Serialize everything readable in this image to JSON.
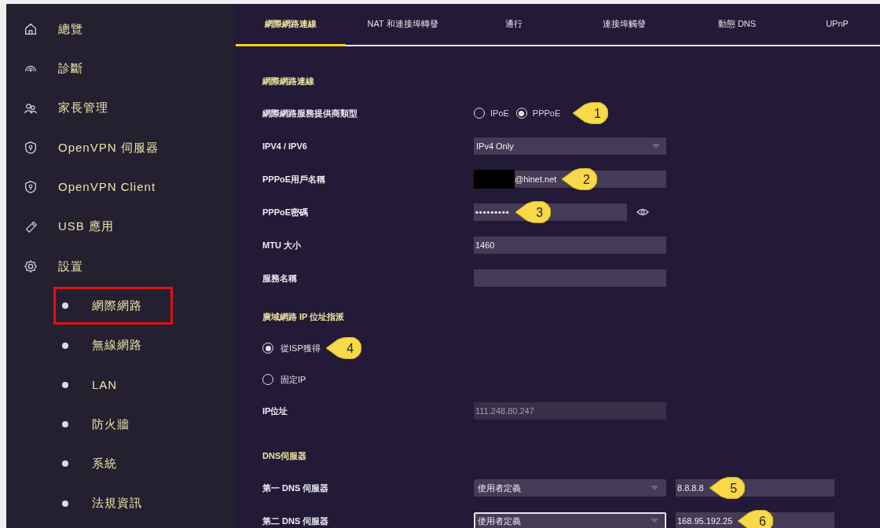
{
  "sidebar": {
    "items": [
      {
        "label": "總覽"
      },
      {
        "label": "診斷"
      },
      {
        "label": "家長管理"
      },
      {
        "label": "OpenVPN 伺服器"
      },
      {
        "label": "OpenVPN Client"
      },
      {
        "label": "USB 應用"
      },
      {
        "label": "設置",
        "children": [
          {
            "label": "網際網路",
            "highlighted": true
          },
          {
            "label": "無線網路",
            "highlighted": false
          },
          {
            "label": "LAN",
            "highlighted": false
          },
          {
            "label": "防火牆",
            "highlighted": false
          },
          {
            "label": "系統",
            "highlighted": false
          },
          {
            "label": "法規資訊",
            "highlighted": false
          }
        ]
      }
    ]
  },
  "tabs": [
    {
      "label": "網際網路連線",
      "selected": true
    },
    {
      "label": "NAT 和連接埠轉發",
      "selected": false
    },
    {
      "label": "通行",
      "selected": false
    },
    {
      "label": "連接埠觸發",
      "selected": false
    },
    {
      "label": "動態 DNS",
      "selected": false
    },
    {
      "label": "UPnP",
      "selected": false
    }
  ],
  "sections": [
    {
      "heading": "網際網路連線",
      "rows": [
        {
          "kind": "radio-group",
          "label": "網際網路服務提供商類型",
          "options": [
            {
              "label": "IPoE",
              "selected": false
            },
            {
              "label": "PPPoE",
              "selected": true
            }
          ],
          "callout": "1"
        },
        {
          "kind": "select",
          "label": "IPV4 / IPV6",
          "value": "IPv4 Only"
        },
        {
          "kind": "text",
          "label": "PPPoE用戶名稱",
          "value": "@hinet.net",
          "redacted": true,
          "callout": "2"
        },
        {
          "kind": "password",
          "label": "PPPoE密碼",
          "value": "•••••••••",
          "callout": "3"
        },
        {
          "kind": "text",
          "label": "MTU 大小",
          "value": "1460"
        },
        {
          "kind": "text",
          "label": "服務名稱"
        }
      ]
    },
    {
      "heading": "廣域網路 IP 位址指派",
      "rows": [
        {
          "kind": "radio",
          "label": "從ISP獲得",
          "selected": true,
          "callout": "4"
        },
        {
          "kind": "radio",
          "label": "固定IP",
          "selected": false
        },
        {
          "kind": "text",
          "label": "IP位址",
          "value": "111.248.80.247",
          "disabled": true
        }
      ]
    },
    {
      "heading": "DNS伺服器",
      "rows": [
        {
          "kind": "dns",
          "label": "第一 DNS 伺服器",
          "mode": "使用者定義",
          "value": "8.8.8.8",
          "focused": false,
          "callout": "5"
        },
        {
          "kind": "dns",
          "label": "第二 DNS 伺服器",
          "mode": "使用者定義",
          "value": "168.95.192.25",
          "focused": true,
          "callout": "6"
        }
      ]
    }
  ]
}
